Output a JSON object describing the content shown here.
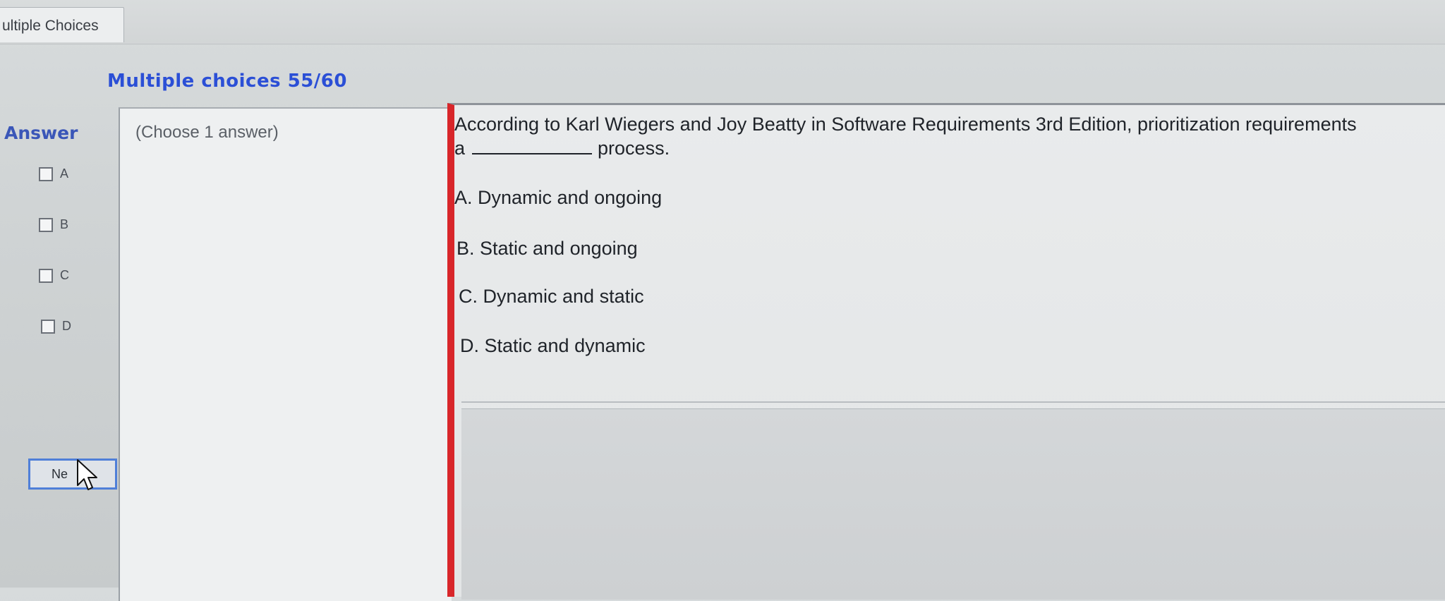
{
  "tab": {
    "label": "ultiple Choices"
  },
  "heading": "Multiple choices 55/60",
  "answer": {
    "title": "Answer",
    "options": [
      "A",
      "B",
      "C",
      "D"
    ]
  },
  "choose": "(Choose 1 answer)",
  "question": {
    "line1": "According to Karl Wiegers and Joy Beatty in Software Requirements 3rd Edition, prioritization requirements",
    "line2_prefix": "a",
    "line2_suffix": "process.",
    "choices": [
      "A. Dynamic and ongoing",
      "B. Static and ongoing",
      "C. Dynamic and static",
      "D. Static and dynamic"
    ]
  },
  "next_button": {
    "label": "Ne"
  },
  "icons": {
    "cursor": "pointer-arrow-icon"
  }
}
